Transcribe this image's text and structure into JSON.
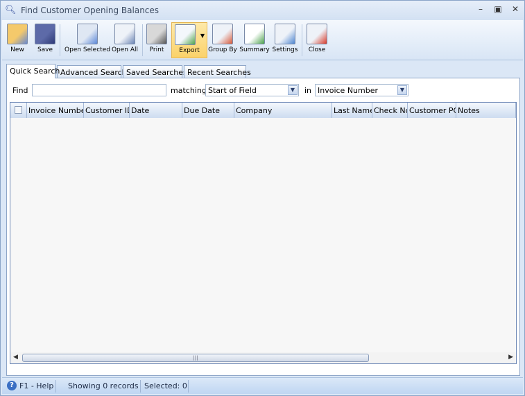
{
  "window": {
    "title": "Find Customer Opening Balances",
    "icon": "binoculars-icon"
  },
  "toolbar": {
    "buttons": [
      {
        "label": "New",
        "icon": "new-customer-icon"
      },
      {
        "label": "Save",
        "icon": "floppy-disk-icon"
      },
      {
        "label": "Open Selected",
        "icon": "open-selected-icon"
      },
      {
        "label": "Open All",
        "icon": "open-all-icon"
      },
      {
        "label": "Print",
        "icon": "printer-icon"
      },
      {
        "label": "Export",
        "icon": "export-icon"
      },
      {
        "label": "Group By",
        "icon": "group-by-icon"
      },
      {
        "label": "Summary",
        "icon": "summary-icon"
      },
      {
        "label": "Settings",
        "icon": "settings-icon"
      },
      {
        "label": "Close",
        "icon": "close-window-icon"
      }
    ]
  },
  "tabs": [
    "Quick Search",
    "Advanced Search",
    "Saved Searches",
    "Recent Searches"
  ],
  "search": {
    "find_label": "Find",
    "find_value": "",
    "matching_label": "matching",
    "matching_value": "Start of Field",
    "in_label": "in",
    "in_value": "Invoice Number"
  },
  "grid": {
    "columns": [
      "Invoice Number",
      "Customer ID",
      "Date",
      "Due Date",
      "Company",
      "Last Name",
      "Check No",
      "Customer PO",
      "Notes"
    ],
    "rows": []
  },
  "status": {
    "help": "F1 - Help",
    "records": "Showing 0 records",
    "selected": "Selected: 0"
  },
  "colors": {
    "accent": "#fbd26a",
    "frame": "#8ea6c8"
  }
}
